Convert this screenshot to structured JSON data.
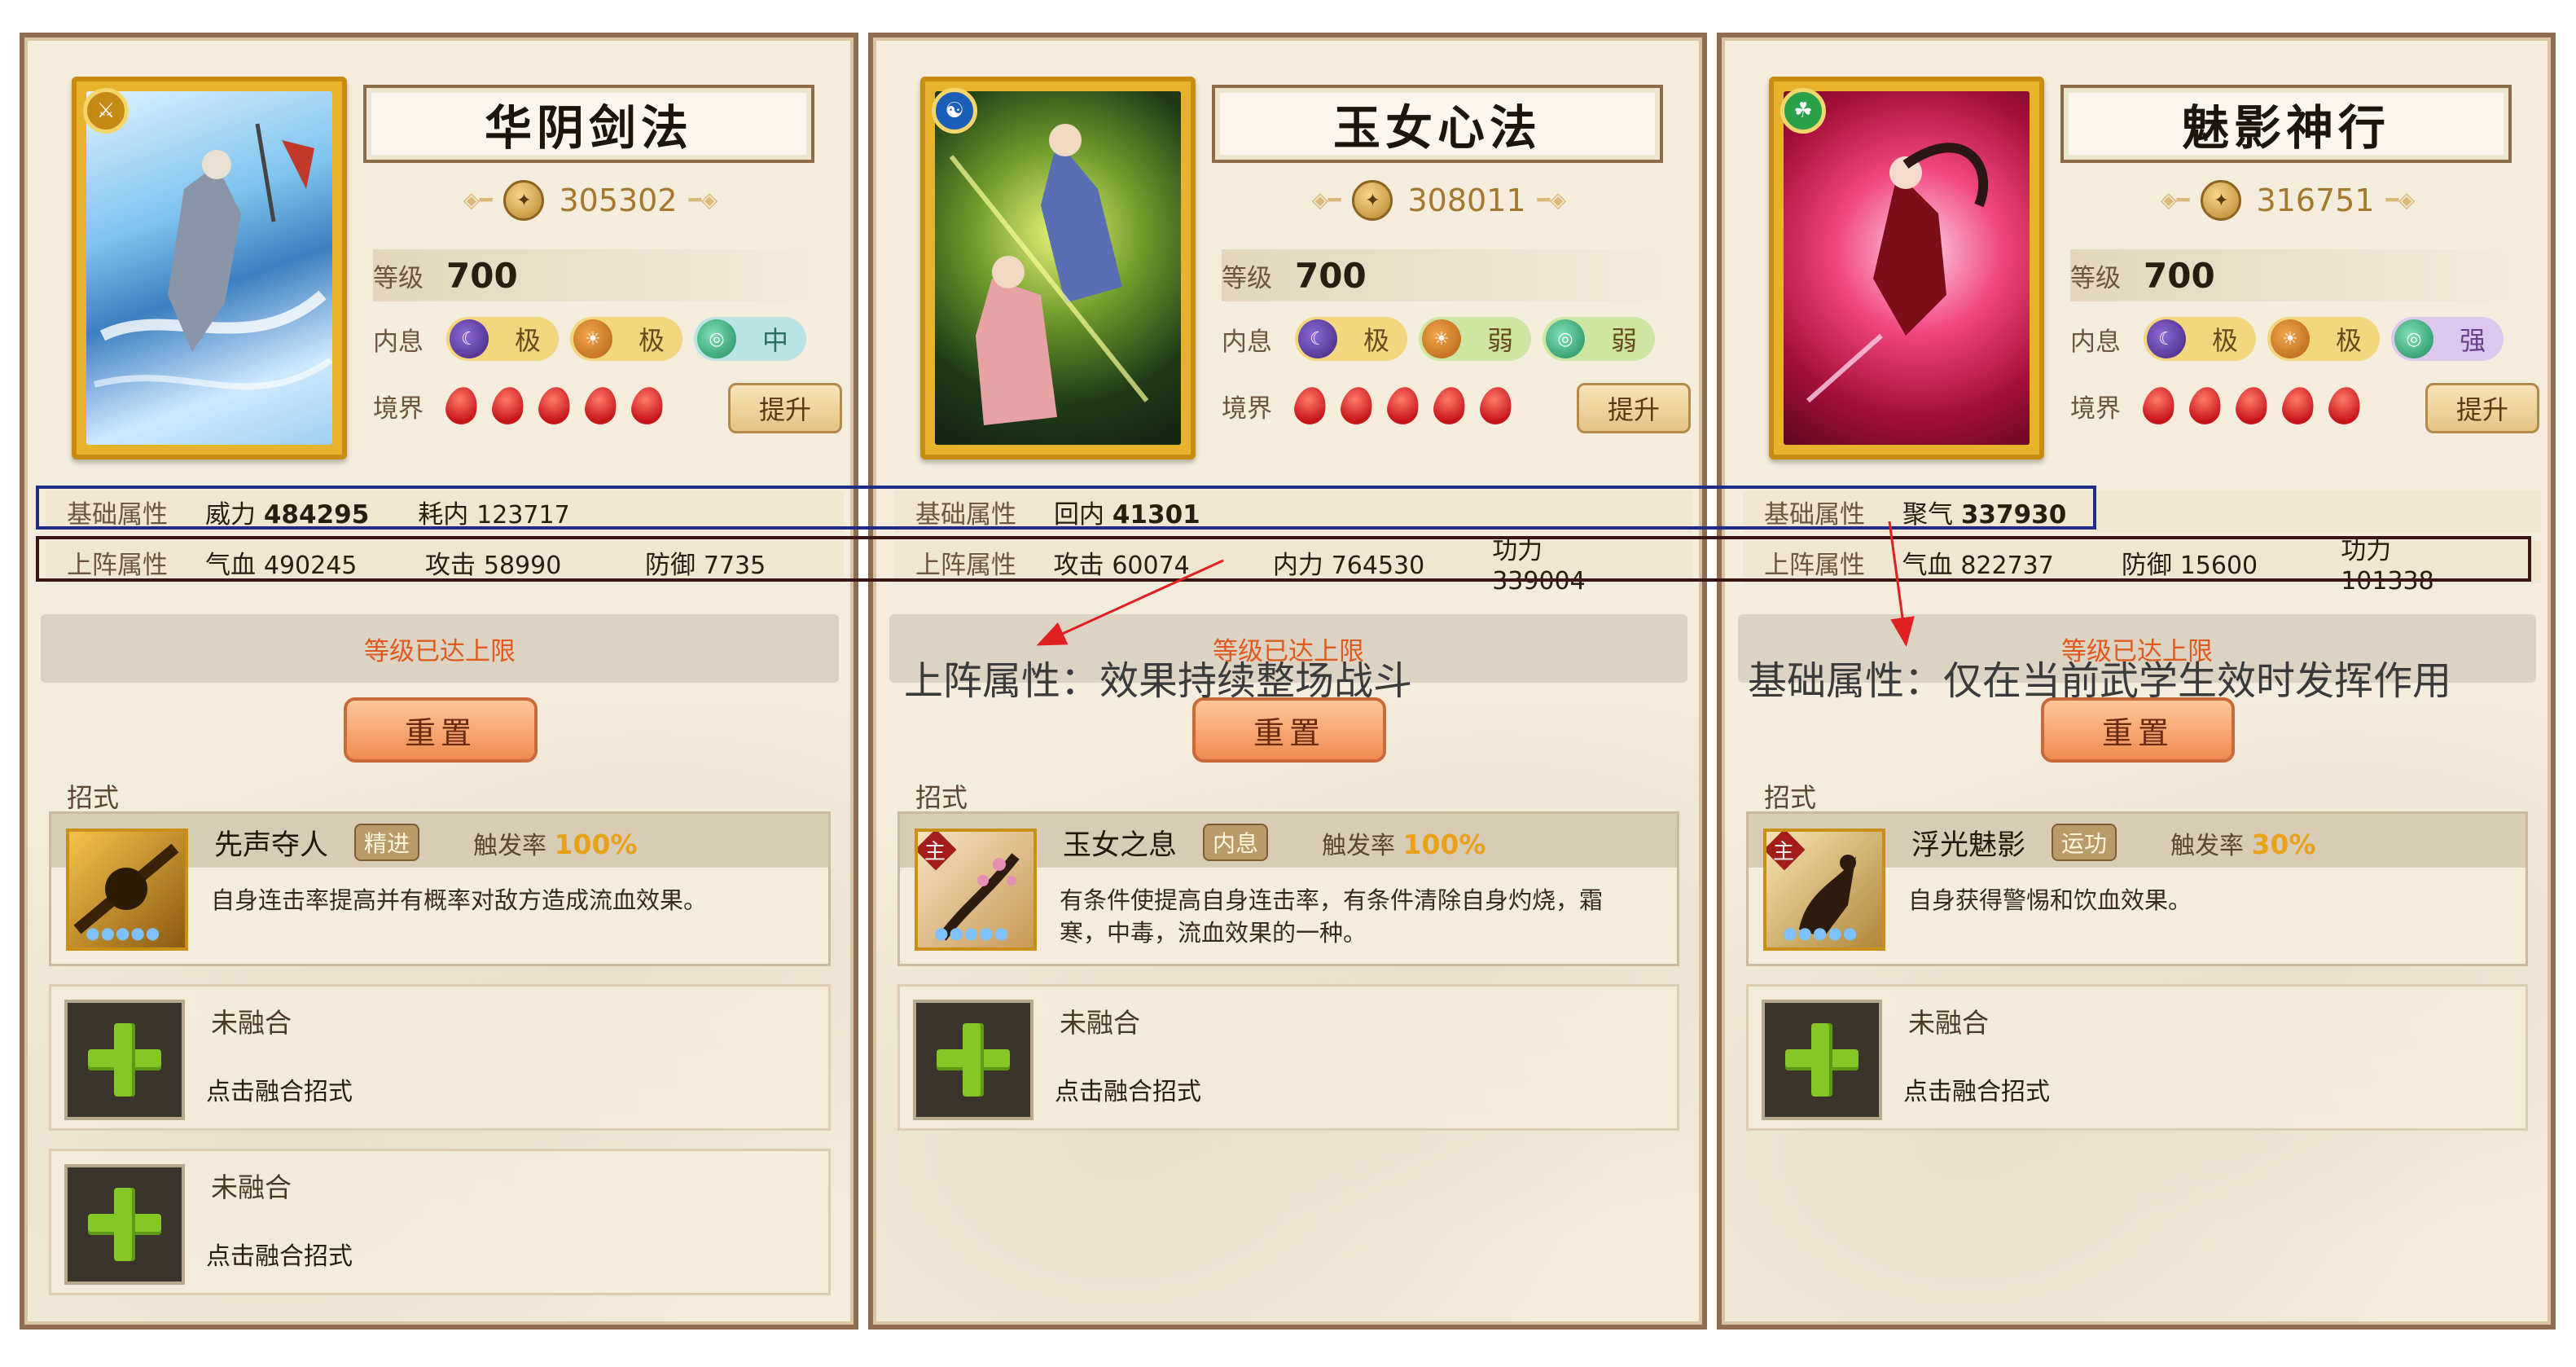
{
  "panels": [
    {
      "title": "华阴剑法",
      "power": "305302",
      "level_label": "等级",
      "level": "700",
      "inner_label": "内息",
      "inner": [
        {
          "icon": "moon-orb-icon",
          "grade": "极",
          "color": "yellow"
        },
        {
          "icon": "sun-orb-icon",
          "grade": "极",
          "color": "yellow"
        },
        {
          "icon": "swirl-orb-icon",
          "grade": "中",
          "color": "blue"
        }
      ],
      "realm_label": "境界",
      "upgrade": "提升",
      "base_label": "基础属性",
      "base": [
        {
          "name": "威力",
          "value": "484295",
          "bold": true
        },
        {
          "name": "耗内",
          "value": "123717"
        }
      ],
      "up_label": "上阵属性",
      "up": [
        {
          "name": "气血",
          "value": "490245"
        },
        {
          "name": "攻击",
          "value": "58990"
        },
        {
          "name": "防御",
          "value": "7735"
        }
      ],
      "max_text": "等级已达上限",
      "reset": "重置",
      "moves_label": "招式",
      "skill": {
        "name": "先声夺人",
        "type": "精进",
        "rate_label": "触发率",
        "rate": "100%",
        "desc": "自身连击率提高并有概率对敌方造成流血效果。",
        "main": false
      },
      "slots": [
        {
          "title": "未融合",
          "action": "点击融合招式"
        },
        {
          "title": "未融合",
          "action": "点击融合招式"
        }
      ]
    },
    {
      "title": "玉女心法",
      "power": "308011",
      "level_label": "等级",
      "level": "700",
      "inner_label": "内息",
      "inner": [
        {
          "icon": "moon-orb-icon",
          "grade": "极",
          "color": "yellow"
        },
        {
          "icon": "sun-orb-icon",
          "grade": "弱",
          "color": "green"
        },
        {
          "icon": "swirl-orb-icon",
          "grade": "弱",
          "color": "green"
        }
      ],
      "realm_label": "境界",
      "upgrade": "提升",
      "base_label": "基础属性",
      "base": [
        {
          "name": "回内",
          "value": "41301",
          "bold": true
        }
      ],
      "up_label": "上阵属性",
      "up": [
        {
          "name": "攻击",
          "value": "60074"
        },
        {
          "name": "内力",
          "value": "764530"
        },
        {
          "name": "功力",
          "value": "339004"
        }
      ],
      "max_text": "等级已达上限",
      "reset": "重置",
      "moves_label": "招式",
      "skill": {
        "name": "玉女之息",
        "type": "内息",
        "rate_label": "触发率",
        "rate": "100%",
        "desc": "有条件使提高自身连击率，有条件清除自身灼烧，霜寒，中毒，流血效果的一种。",
        "main": true,
        "main_label": "主"
      },
      "slots": [
        {
          "title": "未融合",
          "action": "点击融合招式"
        }
      ]
    },
    {
      "title": "魅影神行",
      "power": "316751",
      "level_label": "等级",
      "level": "700",
      "inner_label": "内息",
      "inner": [
        {
          "icon": "moon-orb-icon",
          "grade": "极",
          "color": "yellow"
        },
        {
          "icon": "sun-orb-icon",
          "grade": "极",
          "color": "yellow"
        },
        {
          "icon": "swirl-orb-icon",
          "grade": "强",
          "color": "purple"
        }
      ],
      "realm_label": "境界",
      "upgrade": "提升",
      "base_label": "基础属性",
      "base": [
        {
          "name": "聚气",
          "value": "337930",
          "bold": true
        }
      ],
      "up_label": "上阵属性",
      "up": [
        {
          "name": "气血",
          "value": "822737"
        },
        {
          "name": "防御",
          "value": "15600"
        },
        {
          "name": "功力",
          "value": "101338"
        }
      ],
      "max_text": "等级已达上限",
      "reset": "重置",
      "moves_label": "招式",
      "skill": {
        "name": "浮光魅影",
        "type": "运功",
        "rate_label": "触发率",
        "rate": "30%",
        "desc": "自身获得警惕和饮血效果。",
        "main": true,
        "main_label": "主"
      },
      "slots": [
        {
          "title": "未融合",
          "action": "点击融合招式"
        }
      ]
    }
  ],
  "annotations": {
    "up_note": "上阵属性：效果持续整场战斗",
    "base_note": "基础属性：仅在当前武学生效时发挥作用"
  },
  "colors": {
    "frame": "#8e6e4e",
    "parchment": "#f4ecdc",
    "max_text": "#e05a1e",
    "box_blue": "#1e2e86",
    "box_dark": "#3a1616",
    "arrow": "#e02020"
  }
}
